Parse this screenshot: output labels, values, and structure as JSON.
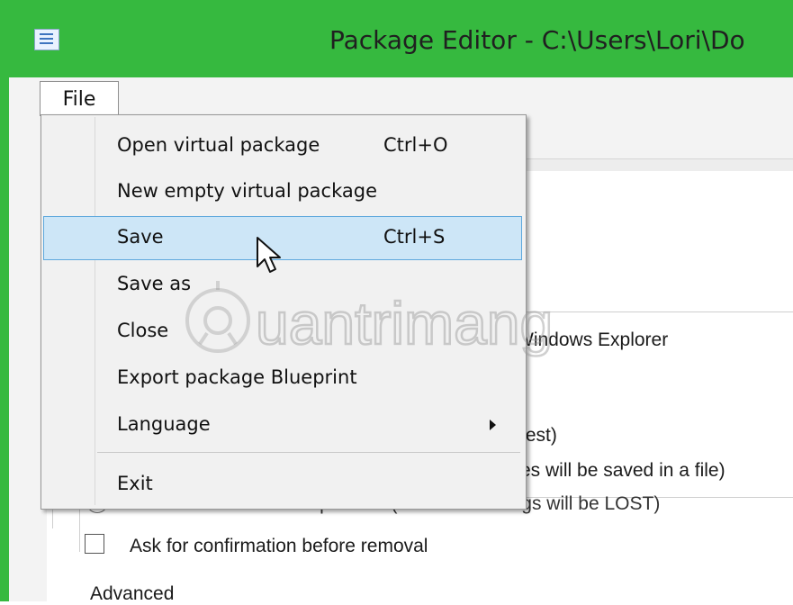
{
  "window": {
    "title": "Package Editor - C:\\Users\\Lori\\Do",
    "frame_color": "#36b93f"
  },
  "menubar": {
    "file_label": "File"
  },
  "file_menu": {
    "items": [
      {
        "label": "Open virtual package",
        "shortcut": "Ctrl+O"
      },
      {
        "label": "New empty virtual package",
        "shortcut": ""
      },
      {
        "label": "Save",
        "shortcut": "Ctrl+S",
        "highlighted": true
      },
      {
        "label": "Save as",
        "shortcut": ""
      },
      {
        "label": "Close",
        "shortcut": ""
      },
      {
        "label": "Export package Blueprint",
        "shortcut": ""
      },
      {
        "label": "Language",
        "shortcut": "",
        "submenu": true
      },
      {
        "label": "Exit",
        "shortcut": ""
      }
    ],
    "highlight_color": "#cde6f7"
  },
  "background": {
    "option_explorer": "Windows Explorer",
    "option_test": "test)",
    "option_saved": "es will be saved in a file)",
    "option_remove": "Remove all virtual data upon exit (data and settings will be LOST)",
    "confirm_label": "Ask for confirmation before removal",
    "advanced_label": "Advanced"
  },
  "watermark": {
    "text": "uantrimang"
  }
}
